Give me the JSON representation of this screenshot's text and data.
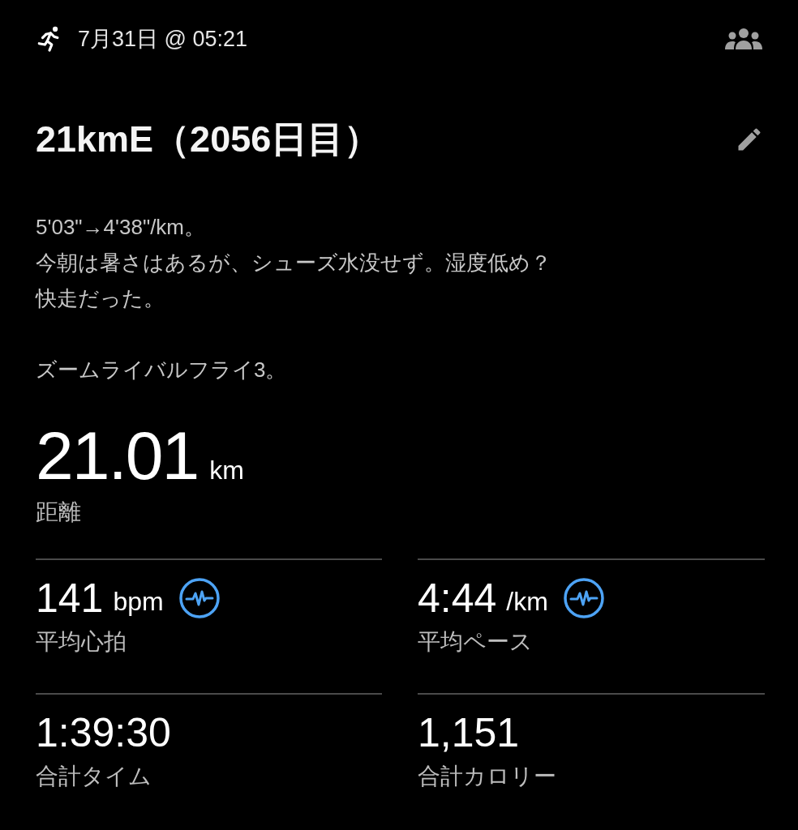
{
  "header": {
    "date": "7月31日 @ 05:21"
  },
  "activity": {
    "title": "21kmE（2056日目）",
    "description": [
      [
        "5'03\"→4'38\"/km。",
        "今朝は暑さはあるが、シューズ水没せず。湿度低め？",
        "快走だった。"
      ],
      [
        "ズームライバルフライ3。"
      ]
    ]
  },
  "distance": {
    "value": "21.01",
    "unit": "km",
    "label": "距離"
  },
  "stats": [
    {
      "value": "141",
      "unit": "bpm",
      "label": "平均心拍",
      "graph_link": true
    },
    {
      "value": "4:44",
      "unit": "/km",
      "label": "平均ペース",
      "graph_link": true
    },
    {
      "value": "1:39:30",
      "label": "合計タイム",
      "graph_link": false
    },
    {
      "value": "1,151",
      "label": "合計カロリー",
      "graph_link": false
    }
  ]
}
